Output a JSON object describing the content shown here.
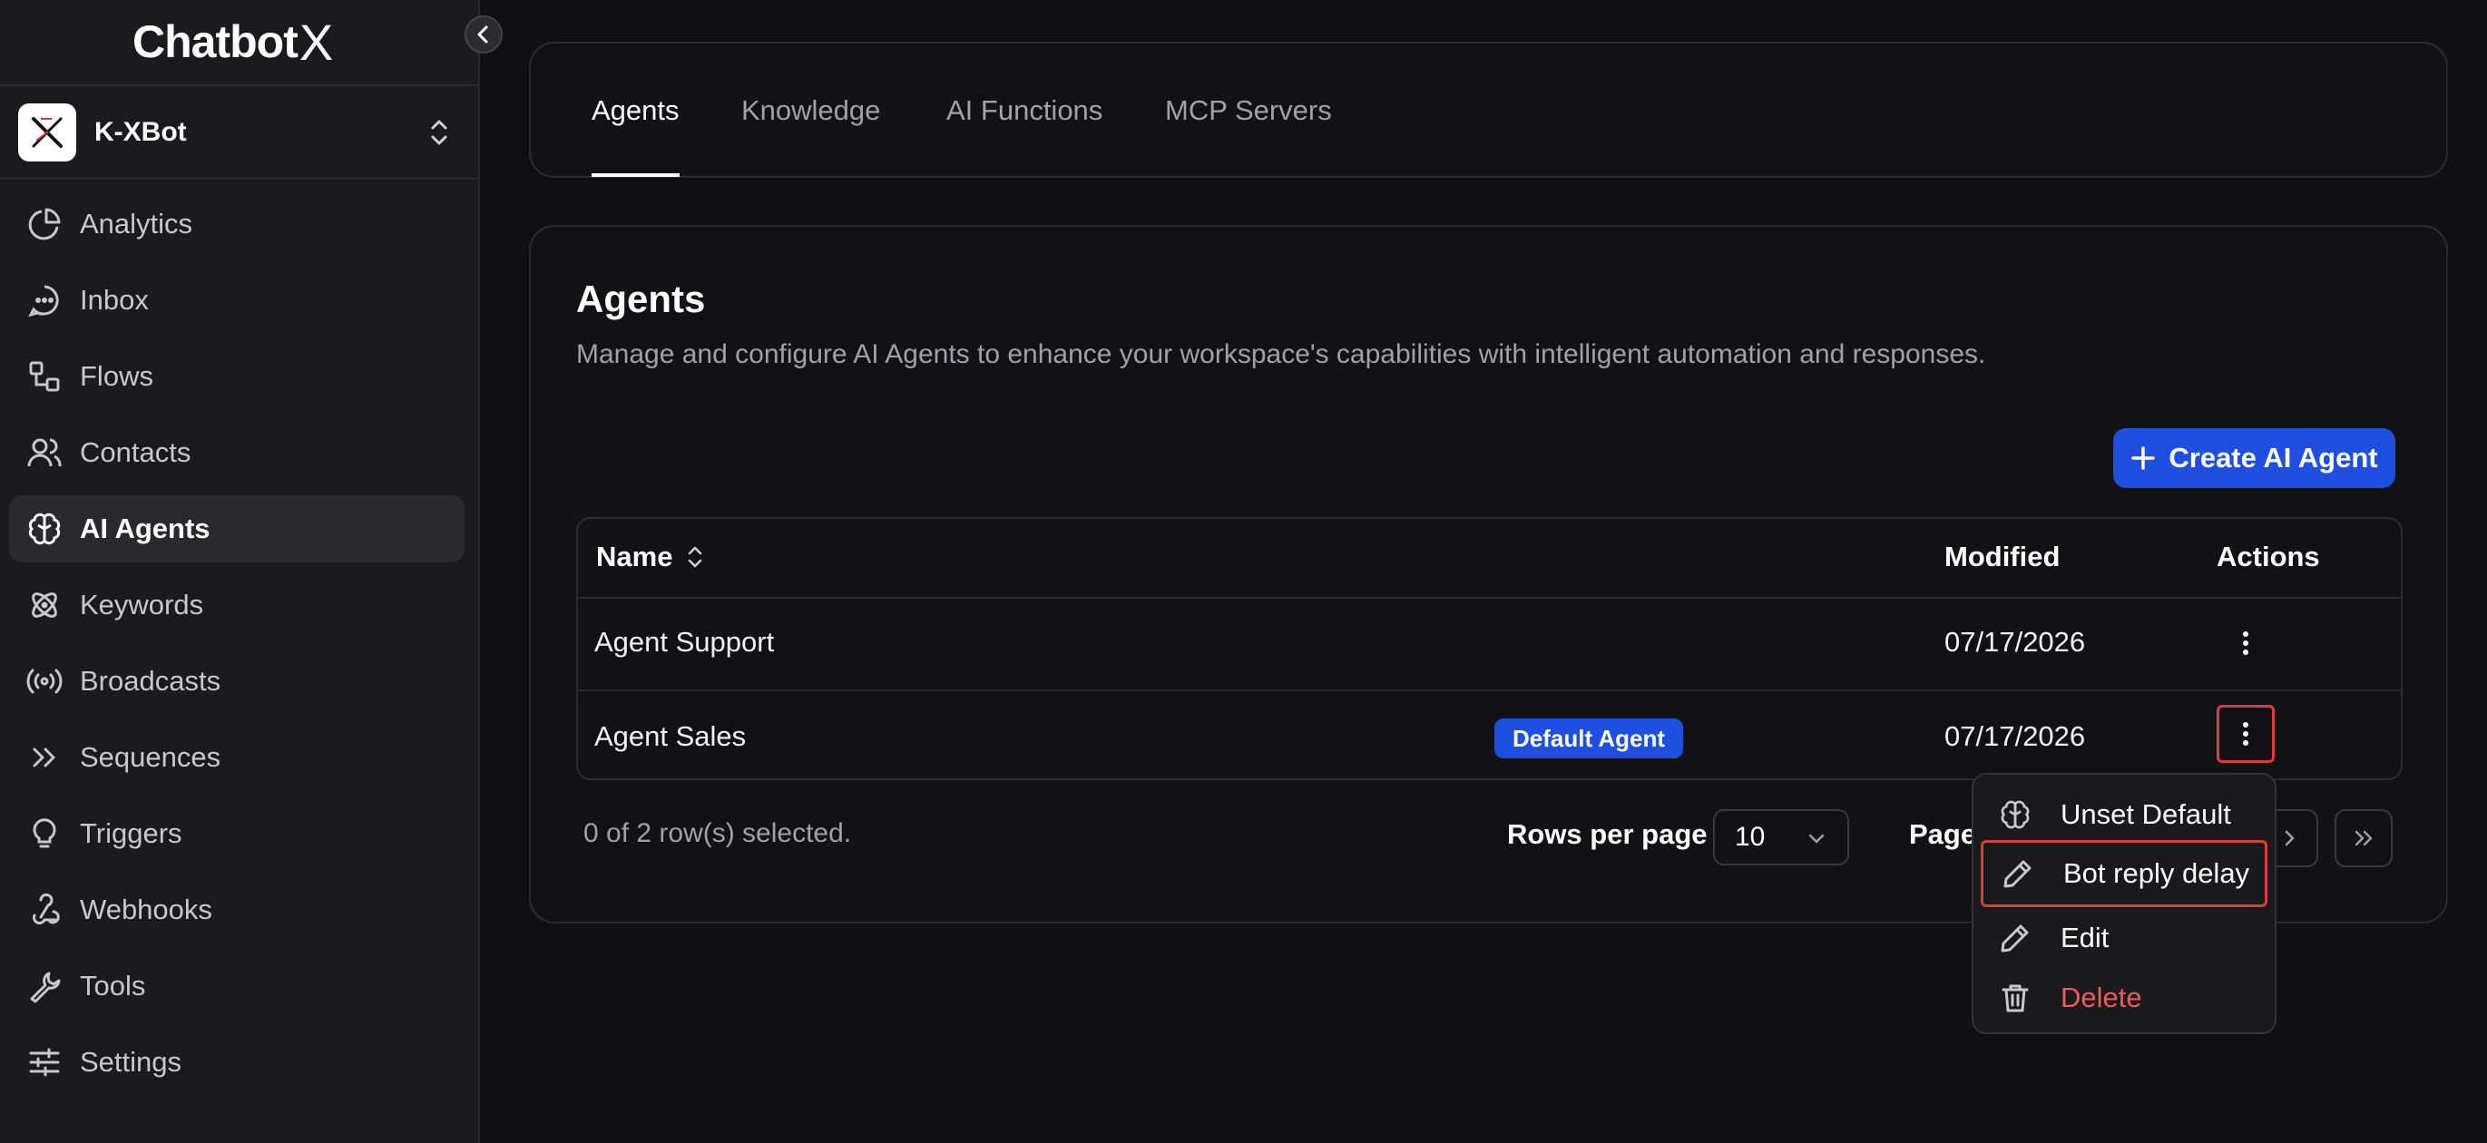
{
  "app": {
    "logo_text": "Chatbot",
    "logo_mark": "X"
  },
  "workspace": {
    "name": "K-XBot"
  },
  "sidebar": {
    "items": [
      {
        "label": "Analytics",
        "icon": "pie-chart-icon"
      },
      {
        "label": "Inbox",
        "icon": "chat-bubble-icon"
      },
      {
        "label": "Flows",
        "icon": "flow-icon"
      },
      {
        "label": "Contacts",
        "icon": "users-icon"
      },
      {
        "label": "AI Agents",
        "icon": "brain-icon",
        "active": true
      },
      {
        "label": "Keywords",
        "icon": "atom-icon"
      },
      {
        "label": "Broadcasts",
        "icon": "broadcast-icon"
      },
      {
        "label": "Sequences",
        "icon": "double-chevron-right-icon"
      },
      {
        "label": "Triggers",
        "icon": "lightbulb-icon"
      },
      {
        "label": "Webhooks",
        "icon": "webhook-icon"
      },
      {
        "label": "Tools",
        "icon": "wrench-icon"
      },
      {
        "label": "Settings",
        "icon": "sliders-icon"
      }
    ]
  },
  "tabs": [
    {
      "label": "Agents",
      "active": true
    },
    {
      "label": "Knowledge"
    },
    {
      "label": "AI Functions"
    },
    {
      "label": "MCP Servers"
    }
  ],
  "main": {
    "title": "Agents",
    "description": "Manage and configure AI Agents to enhance your workspace's capabilities with intelligent automation and responses.",
    "create_button": "Create AI Agent"
  },
  "table": {
    "columns": {
      "name": "Name",
      "modified": "Modified",
      "actions": "Actions"
    },
    "rows": [
      {
        "name": "Agent Support",
        "badge": "",
        "modified": "07/17/2026"
      },
      {
        "name": "Agent Sales",
        "badge": "Default Agent",
        "modified": "07/17/2026"
      }
    ]
  },
  "footer": {
    "selection": "0 of 2 row(s) selected.",
    "rows_per_page_label": "Rows per page",
    "rows_per_page_value": "10",
    "page_label": "Page"
  },
  "menu": {
    "items": [
      {
        "label": "Unset Default",
        "icon": "brain-icon"
      },
      {
        "label": "Bot reply delay",
        "icon": "pencil-icon",
        "highlight": true
      },
      {
        "label": "Edit",
        "icon": "pencil-icon"
      },
      {
        "label": "Delete",
        "icon": "trash-icon",
        "danger": true
      }
    ]
  },
  "colors": {
    "accent": "#1e4fe0",
    "danger": "#ef5a5a",
    "highlight_outline": "#e03a3a",
    "background": "#101012",
    "sidebar": "#1b1b1d"
  }
}
